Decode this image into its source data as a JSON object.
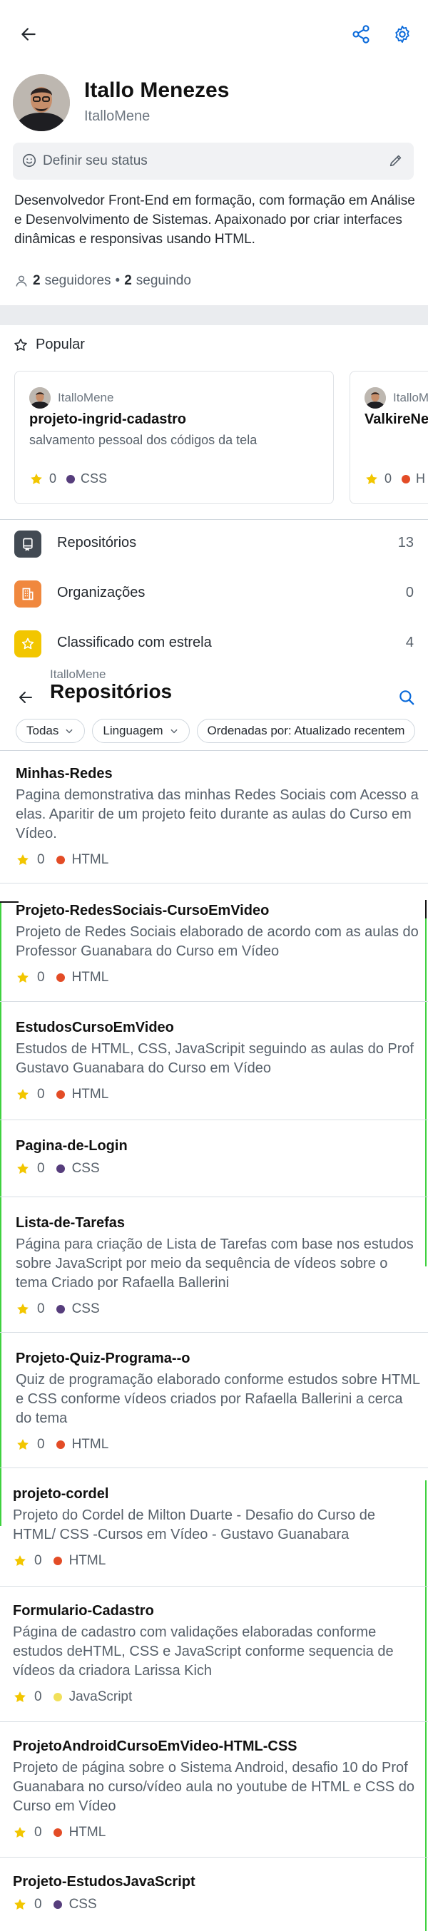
{
  "profile": {
    "name": "Itallo Menezes",
    "login": "ItalloMene",
    "status_placeholder": "Definir seu status",
    "bio": "Desenvolvedor Front-End em formação, com formação em Análise e Desenvolvimento de Sistemas. Apaixonado por criar interfaces dinâmicas e responsivas usando HTML.",
    "followers_count": "2",
    "followers_label": "seguidores",
    "separator": "•",
    "following_count": "2",
    "following_label": "seguindo"
  },
  "popular": {
    "title": "Popular",
    "cards": [
      {
        "owner": "ItalloMene",
        "name": "projeto-ingrid-cadastro",
        "description": "salvamento pessoal dos códigos da tela",
        "stars": "0",
        "language": "CSS",
        "language_color": "#563d7c"
      },
      {
        "owner": "ItalloMene",
        "name": "ValkireNe",
        "description": "",
        "stars": "0",
        "language": "H",
        "language_color": "#e34c26"
      }
    ]
  },
  "menu": [
    {
      "label": "Repositórios",
      "count": "13",
      "icon": "repo-icon",
      "color": "#424a53"
    },
    {
      "label": "Organizações",
      "count": "0",
      "icon": "organization-icon",
      "color": "#f0883e"
    },
    {
      "label": "Classificado com estrela",
      "count": "4",
      "icon": "star-icon",
      "color": "#f2c600"
    }
  ],
  "repos_view": {
    "owner": "ItalloMene",
    "title": "Repositórios",
    "filters": [
      {
        "label": "Todas"
      },
      {
        "label": "Linguagem"
      },
      {
        "label": "Ordenadas por: Atualizado recentem"
      }
    ]
  },
  "repositories": [
    {
      "name": "Minhas-Redes",
      "description": "Pagina demonstrativa das minhas Redes Sociais com Acesso a elas. Aparitir de um projeto feito durante as aulas do Curso em Vídeo.",
      "stars": "0",
      "language": "HTML",
      "language_color": "#e34c26"
    },
    {
      "name": "Projeto-RedesSociais-CursoEmVideo",
      "description": "Projeto de Redes Sociais elaborado de acordo com as aulas do Professor Guanabara do Curso em Vídeo",
      "stars": "0",
      "language": "HTML",
      "language_color": "#e34c26"
    },
    {
      "name": "EstudosCursoEmVideo",
      "description": "Estudos de HTML, CSS, JavaScripit seguindo as aulas do Prof Gustavo Guanabara do Curso em Vídeo",
      "stars": "0",
      "language": "HTML",
      "language_color": "#e34c26"
    },
    {
      "name": "Pagina-de-Login",
      "description": "",
      "stars": "0",
      "language": "CSS",
      "language_color": "#563d7c"
    },
    {
      "name": "Lista-de-Tarefas",
      "description": "Página para criação de Lista de Tarefas com base nos estudos sobre JavaScript por meio da sequência de vídeos sobre o tema Criado por Rafaella Ballerini",
      "stars": "0",
      "language": "CSS",
      "language_color": "#563d7c"
    },
    {
      "name": "Projeto-Quiz-Programa--o",
      "description": "Quiz de programação elaborado conforme estudos sobre HTML e CSS conforme vídeos criados por Rafaella Ballerini a cerca do tema",
      "stars": "0",
      "language": "HTML",
      "language_color": "#e34c26"
    },
    {
      "name": "projeto-cordel",
      "description": "Projeto do Cordel de Milton Duarte - Desafio do Curso de HTML/ CSS -Cursos em Vídeo - Gustavo Guanabara",
      "stars": "0",
      "language": "HTML",
      "language_color": "#e34c26"
    },
    {
      "name": "Formulario-Cadastro",
      "description": "Página de cadastro com validações elaboradas conforme estudos deHTML, CSS e JavaScript conforme sequencia de vídeos da criadora Larissa Kich",
      "stars": "0",
      "language": "JavaScript",
      "language_color": "#f1e05a"
    },
    {
      "name": "ProjetoAndroidCursoEmVideo-HTML-CSS",
      "description": "Projeto de página sobre o Sistema Android, desafio 10 do Prof Guanabara no curso/vídeo aula no youtube de HTML e CSS do Curso em Vídeo",
      "stars": "0",
      "language": "HTML",
      "language_color": "#e34c26"
    },
    {
      "name": "Projeto-EstudosJavaScript",
      "description": "",
      "stars": "0",
      "language": "CSS",
      "language_color": "#563d7c"
    }
  ],
  "colors": {
    "accent": "#0969da",
    "star": "#f2c600",
    "highlight_green": "#3fd13f"
  }
}
